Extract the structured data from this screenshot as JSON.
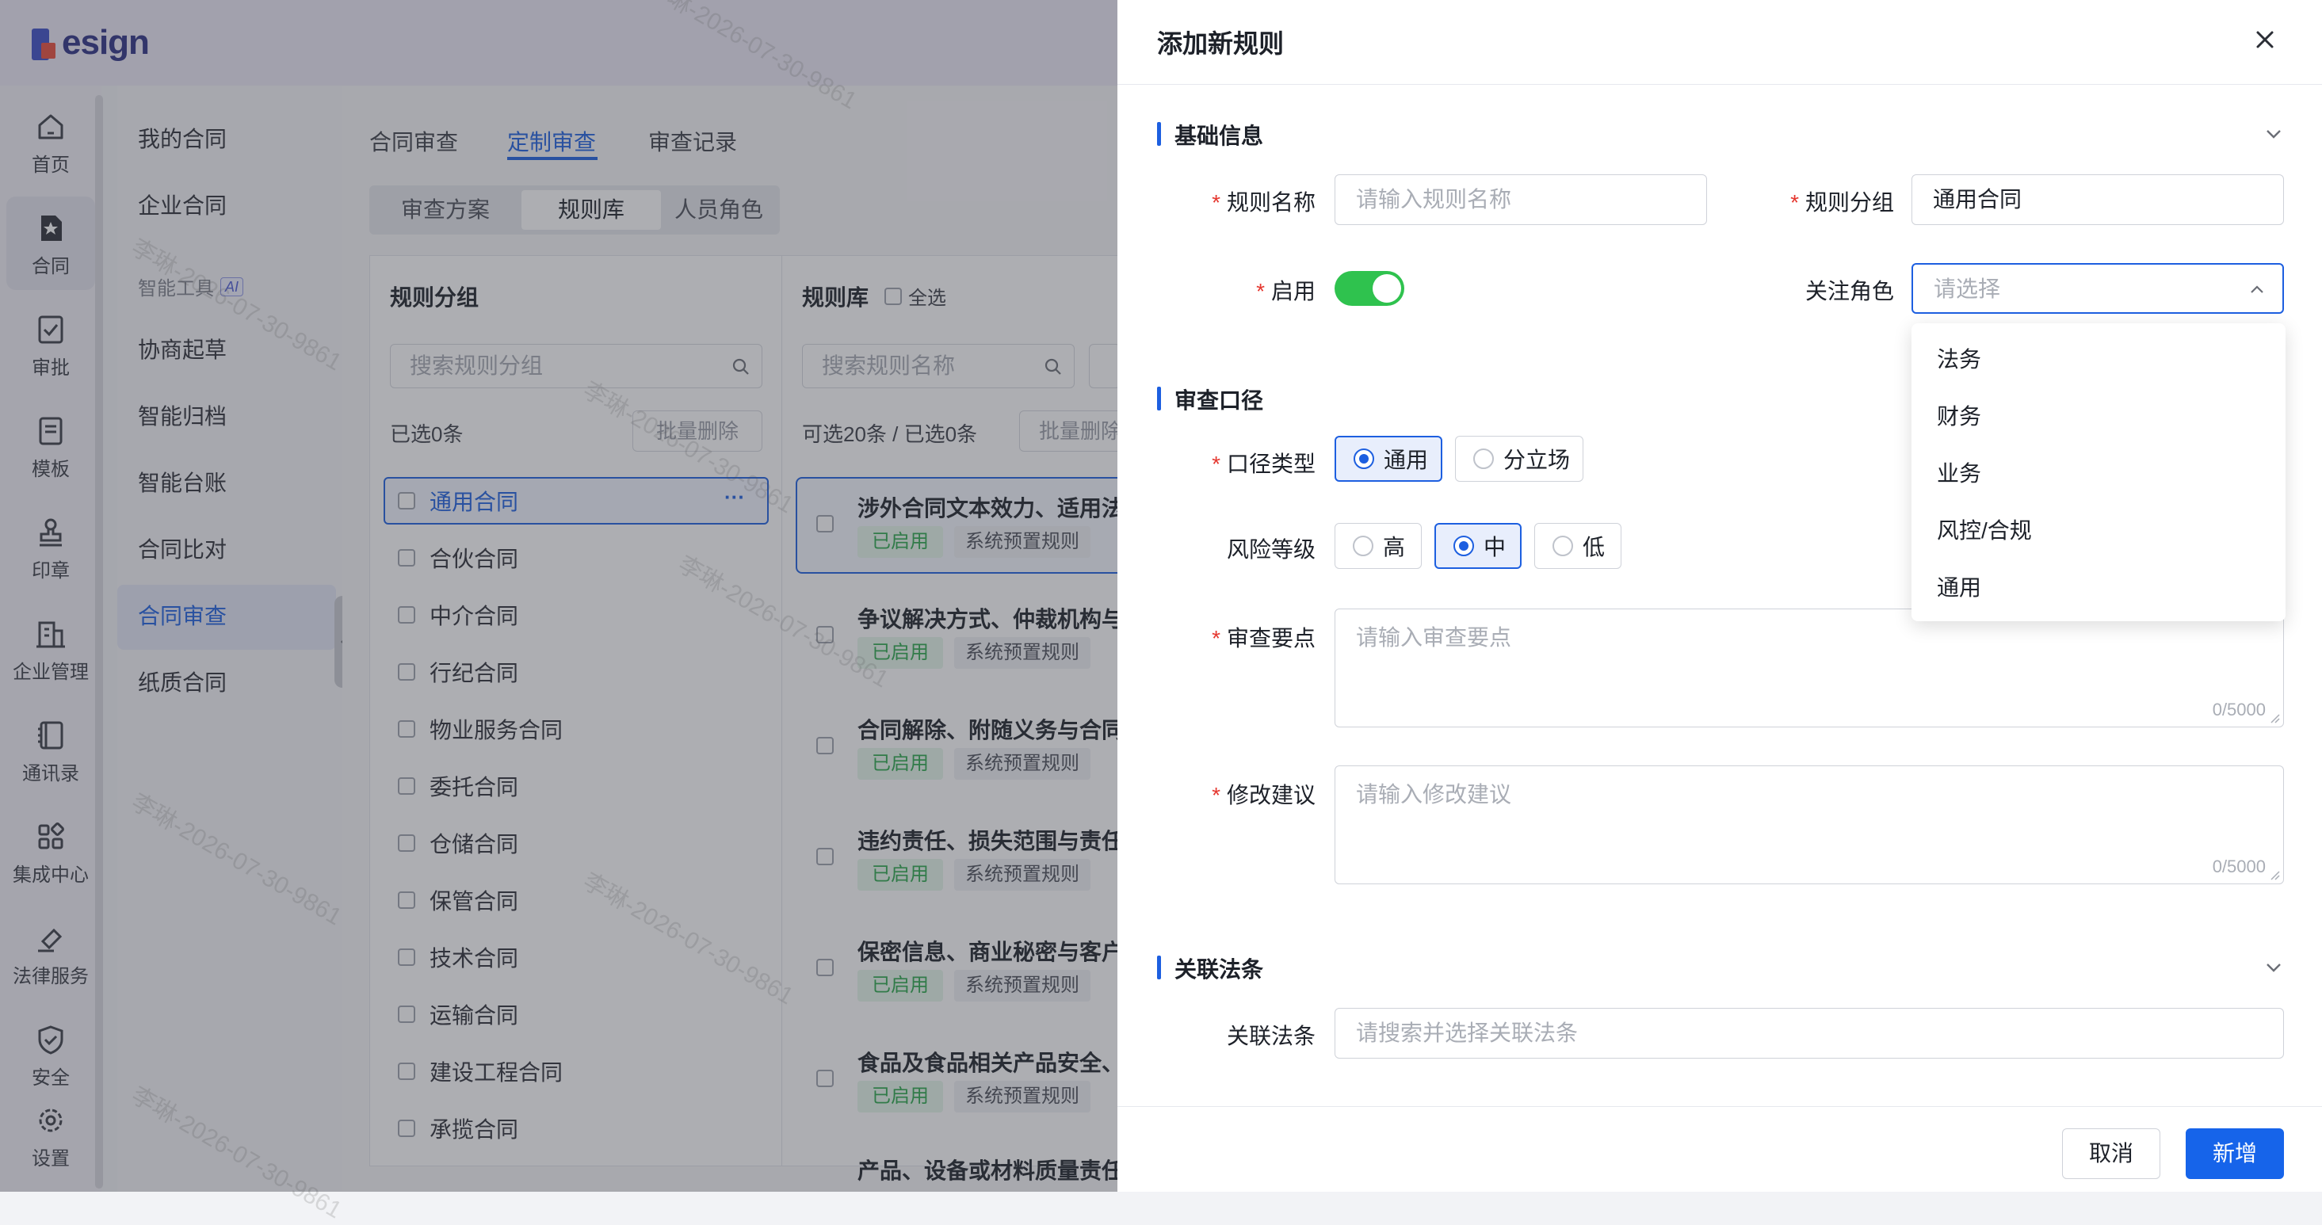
{
  "brand": {
    "name": "esign"
  },
  "leftnav": [
    {
      "label": "首页",
      "icon": "home-icon"
    },
    {
      "label": "合同",
      "icon": "contract-icon"
    },
    {
      "label": "审批",
      "icon": "approval-icon"
    },
    {
      "label": "模板",
      "icon": "template-icon"
    },
    {
      "label": "印章",
      "icon": "seal-icon"
    },
    {
      "label": "企业管理",
      "icon": "enterprise-icon"
    },
    {
      "label": "通讯录",
      "icon": "contacts-icon"
    },
    {
      "label": "集成中心",
      "icon": "integration-icon"
    },
    {
      "label": "法律服务",
      "icon": "legal-icon"
    },
    {
      "label": "安全",
      "icon": "shield-icon"
    },
    {
      "label": "设置",
      "icon": "gear-icon"
    }
  ],
  "subnav": {
    "items_top": [
      "我的合同",
      "企业合同"
    ],
    "group_label": "智能工具",
    "ai_badge": "AI",
    "items_bottom": [
      "协商起草",
      "智能归档",
      "智能台账",
      "合同比对",
      "合同审查",
      "纸质合同"
    ]
  },
  "main": {
    "tabs": [
      "合同审查",
      "定制审查",
      "审查记录"
    ],
    "segments": [
      "审查方案",
      "规则库",
      "人员角色"
    ],
    "group_panel": {
      "title": "规则分组",
      "search_placeholder": "搜索规则分组",
      "selected_count": "已选0条",
      "batch_delete": "批量删除",
      "more": "···",
      "groups": [
        "通用合同",
        "合伙合同",
        "中介合同",
        "行纪合同",
        "物业服务合同",
        "委托合同",
        "仓储合同",
        "保管合同",
        "技术合同",
        "运输合同",
        "建设工程合同",
        "承揽合同"
      ]
    },
    "rule_panel": {
      "title": "规则库",
      "select_all": "全选",
      "search_placeholder": "搜索规则名称",
      "count_text": "可选20条 / 已选0条",
      "batch_delete": "批量删除",
      "rules": [
        {
          "title": "涉外合同文本效力、适用法",
          "status": "已启用",
          "source": "系统预置规则"
        },
        {
          "title": "争议解决方式、仲裁机构与",
          "status": "已启用",
          "source": "系统预置规则"
        },
        {
          "title": "合同解除、附随义务与合同",
          "status": "已启用",
          "source": "系统预置规则"
        },
        {
          "title": "违约责任、损失范围与责任",
          "status": "已启用",
          "source": "系统预置规则"
        },
        {
          "title": "保密信息、商业秘密与客户",
          "status": "已启用",
          "source": "系统预置规则"
        },
        {
          "title": "食品及食品相关产品安全、",
          "status": "已启用",
          "source": "系统预置规则"
        },
        {
          "title": "产品、设备或材料质量责任",
          "status": "",
          "source": ""
        }
      ]
    },
    "watermark": "李琳-2026-07-30-9861"
  },
  "drawer": {
    "title": "添加新规则",
    "sections": {
      "basic": "基础信息",
      "review": "审查口径",
      "law": "关联法条"
    },
    "fields": {
      "rule_name": {
        "label": "规则名称",
        "placeholder": "请输入规则名称"
      },
      "rule_group": {
        "label": "规则分组",
        "value": "通用合同"
      },
      "enabled": {
        "label": "启用",
        "value": true
      },
      "focus_role": {
        "label": "关注角色",
        "placeholder": "请选择"
      },
      "scope_type": {
        "label": "口径类型",
        "options": [
          "通用",
          "分立场"
        ],
        "selected": "通用"
      },
      "risk_level": {
        "label": "风险等级",
        "options": [
          "高",
          "中",
          "低"
        ],
        "selected": "中"
      },
      "key_points": {
        "label": "审查要点",
        "placeholder": "请输入审查要点",
        "counter": "0/5000"
      },
      "suggestion": {
        "label": "修改建议",
        "placeholder": "请输入修改建议",
        "counter": "0/5000"
      },
      "related_law": {
        "label": "关联法条",
        "placeholder": "请搜索并选择关联法条"
      }
    },
    "role_options": [
      "法务",
      "财务",
      "业务",
      "风控/合规",
      "通用"
    ],
    "buttons": {
      "cancel": "取消",
      "submit": "新增"
    }
  },
  "colors": {
    "primary": "#1d5fe0",
    "toggle_on": "#2fc24e",
    "required": "#e5372f",
    "enabled_tag": "#2aa84a"
  }
}
